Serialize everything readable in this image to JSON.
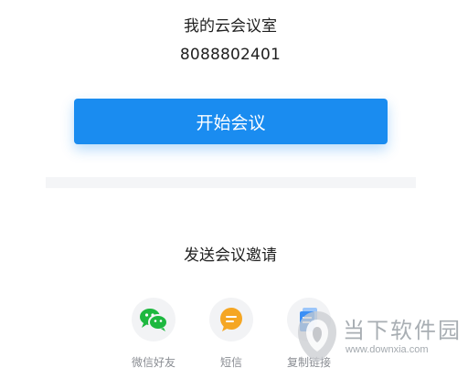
{
  "room": {
    "title": "我的云会议室",
    "number": "8088802401"
  },
  "start_button": {
    "label": "开始会议",
    "color": "#1a8cf0"
  },
  "invite": {
    "title": "发送会议邀请",
    "options": [
      {
        "label": "微信好友",
        "icon": "wechat-icon",
        "color": "#1db83f"
      },
      {
        "label": "短信",
        "icon": "sms-icon",
        "color": "#f5a623"
      },
      {
        "label": "复制链接",
        "icon": "copy-link-icon",
        "color": "#3b8ff5"
      }
    ]
  },
  "watermark": {
    "text": "当下软件园",
    "url": "www.downxia.com"
  }
}
